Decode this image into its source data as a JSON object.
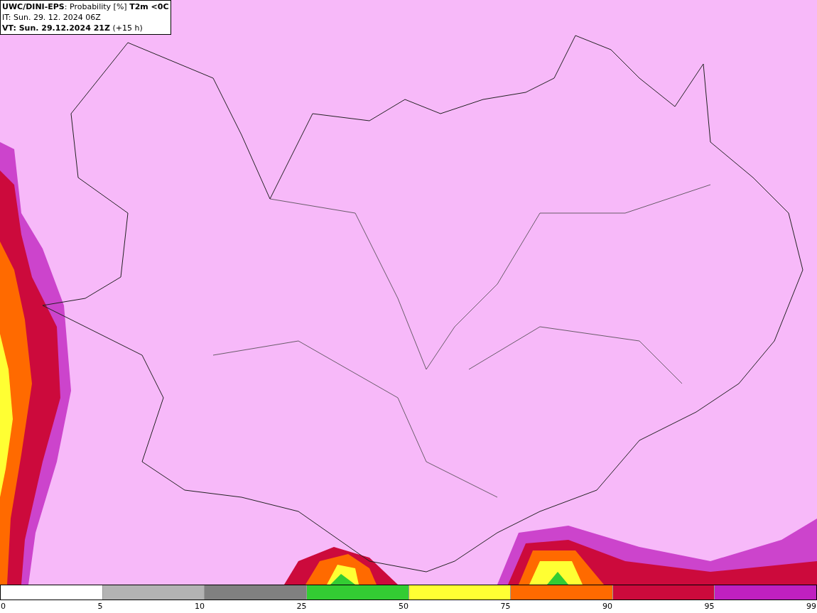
{
  "header": {
    "lines": [
      "**UWC/DINI-EPS**: Probability [%] **T2m <0C**",
      "IT: Sun. 29. 12. 2024 06Z",
      "**VT: Sun. 29.12.2024 21Z** (+15 h)"
    ]
  },
  "legend": {
    "segments": [
      {
        "color": "#ffffff"
      },
      {
        "color": "#b3b3b3"
      },
      {
        "color": "#808080"
      },
      {
        "color": "#33cc33"
      },
      {
        "color": "#ffff33"
      },
      {
        "color": "#ff6a00"
      },
      {
        "color": "#cc0a3c"
      },
      {
        "color": "#c020c0"
      }
    ],
    "labels": [
      "0",
      "5",
      "10",
      "25",
      "50",
      "75",
      "90",
      "95",
      "99"
    ]
  }
}
